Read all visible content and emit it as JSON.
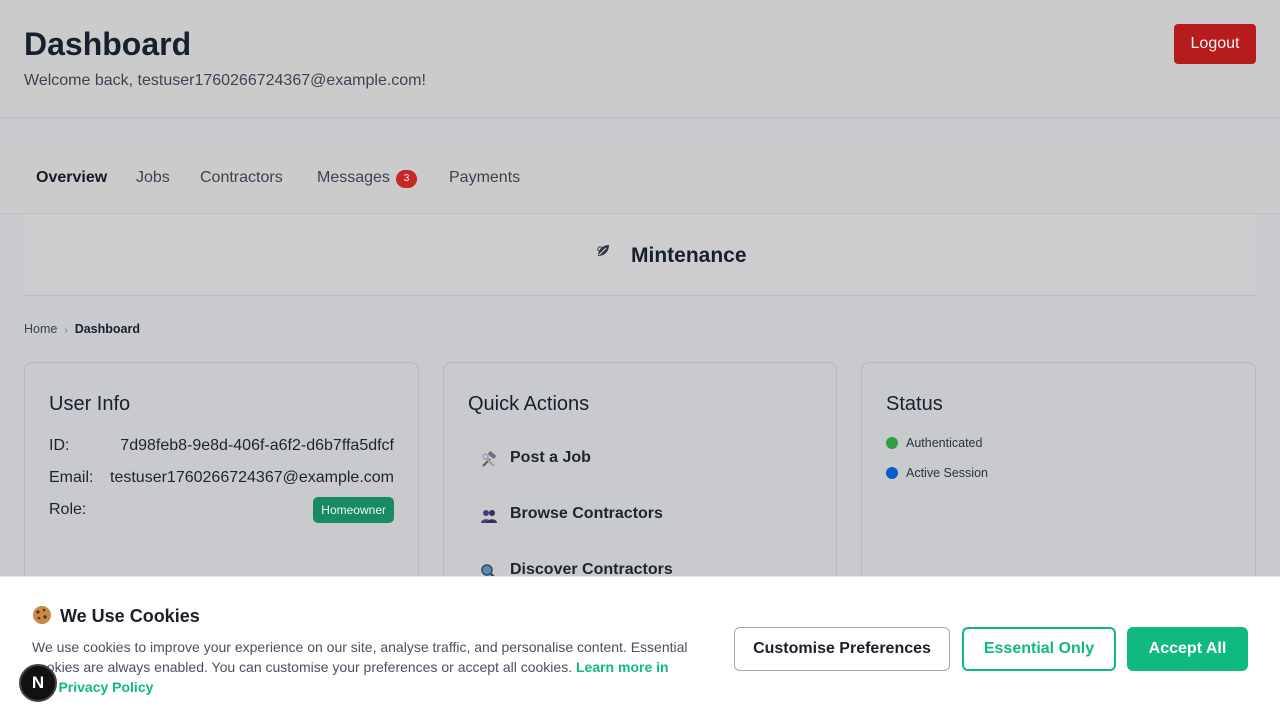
{
  "header": {
    "title": "Dashboard",
    "welcome": "Welcome back, testuser1760266724367@example.com!",
    "logout_label": "Logout"
  },
  "nav": {
    "items": [
      {
        "label": "Overview",
        "active": true
      },
      {
        "label": "Jobs"
      },
      {
        "label": "Contractors"
      },
      {
        "label": "Messages",
        "badge": "3"
      },
      {
        "label": "Payments"
      }
    ]
  },
  "brand": {
    "name": "Mintenance",
    "icon": "leaf-logo-icon"
  },
  "breadcrumb": {
    "home": "Home",
    "current": "Dashboard"
  },
  "user_info": {
    "title": "User Info",
    "id_label": "ID:",
    "id_value": "7d98feb8-9e8d-406f-a6f2-d6b7ffa5dfcf",
    "email_label": "Email:",
    "email_value": "testuser1760266724367@example.com",
    "role_label": "Role:",
    "role_value": "Homeowner"
  },
  "quick_actions": {
    "title": "Quick Actions",
    "items": [
      {
        "label": "Post a Job",
        "icon": "hammer-wrench-icon"
      },
      {
        "label": "Browse Contractors",
        "icon": "people-icon"
      },
      {
        "label": "Discover Contractors",
        "icon": "magnifier-icon"
      }
    ]
  },
  "status": {
    "title": "Status",
    "items": [
      {
        "label": "Authenticated",
        "color": "#2ea043"
      },
      {
        "label": "Active Session",
        "color": "#0a5bd0"
      }
    ]
  },
  "cookie": {
    "title": "We Use Cookies",
    "text": "We use cookies to improve your experience on our site, analyse traffic, and personalise content. Essential cookies are always enabled. You can customise your preferences or accept all cookies.",
    "link": "Learn more in our Privacy Policy",
    "customise_label": "Customise Preferences",
    "essential_label": "Essential Only",
    "accept_label": "Accept All"
  },
  "dev_badge": {
    "label": "N"
  },
  "colors": {
    "accent": "#10b981",
    "danger": "#b71c1c",
    "role_badge": "#1a8a63"
  }
}
